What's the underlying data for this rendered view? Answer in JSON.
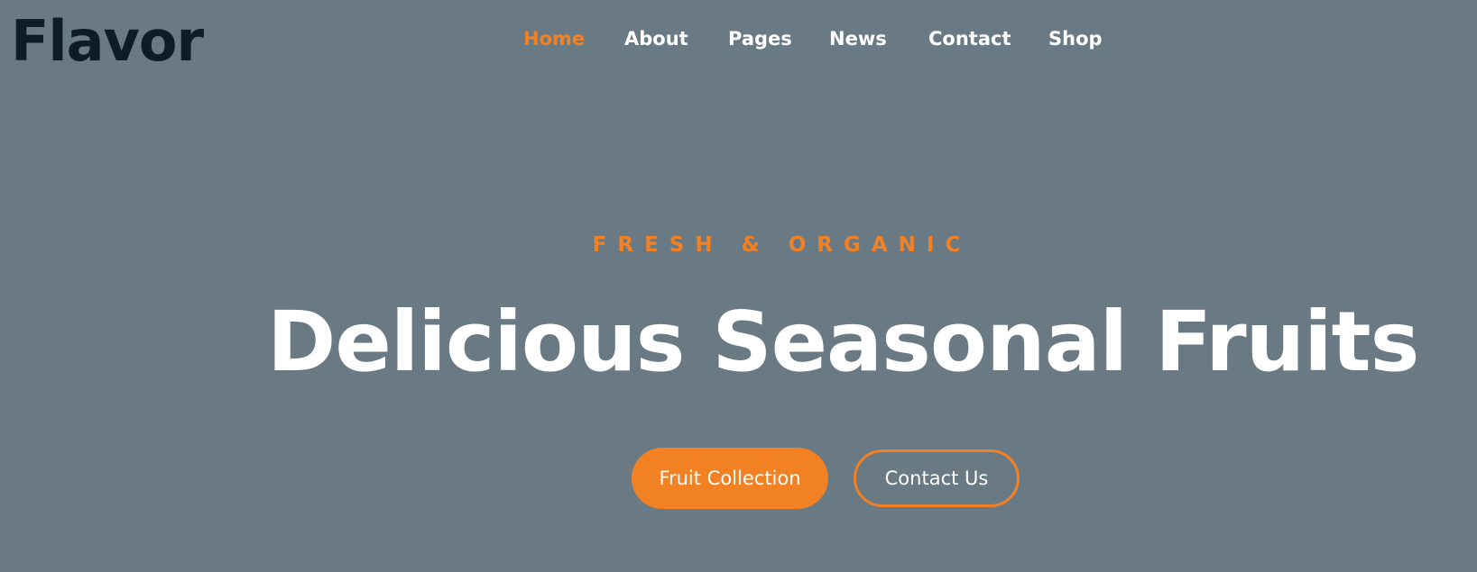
{
  "brand": {
    "logo_text": "Flavor"
  },
  "nav": {
    "items": [
      {
        "label": "Home",
        "active": true
      },
      {
        "label": "About",
        "active": false
      },
      {
        "label": "Pages",
        "active": false
      },
      {
        "label": "News",
        "active": false
      },
      {
        "label": "Contact",
        "active": false
      },
      {
        "label": "Shop",
        "active": false
      }
    ]
  },
  "hero": {
    "eyebrow": "FRESH & ORGANIC",
    "headline": "Delicious Seasonal Fruits",
    "primary_button": "Fruit Collection",
    "secondary_button": "Contact Us"
  },
  "colors": {
    "background": "#6a7a84",
    "accent": "#f28123",
    "logo": "#0d1c26",
    "text": "#ffffff"
  }
}
